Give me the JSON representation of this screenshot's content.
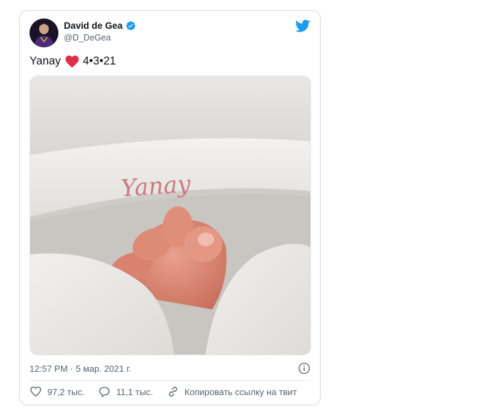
{
  "author": {
    "name": "David de Gea",
    "handle": "@D_DeGea",
    "verified": true
  },
  "tweet": {
    "text_prefix": "Yanay",
    "text_suffix": "4•3•21",
    "timestamp": "12:57 PM · 5 мар. 2021 г.",
    "image_embroidery": "Yanay"
  },
  "actions": {
    "likes": "97,2 тыс.",
    "replies": "11,1 тыс.",
    "copy_link": "Копировать ссылку на твит"
  },
  "icons": {
    "brand": "twitter-bird-icon",
    "verified": "verified-badge-icon",
    "info": "info-icon",
    "like": "heart-outline-icon",
    "reply": "reply-bubble-icon",
    "link": "link-icon"
  },
  "colors": {
    "twitter_blue": "#1d9bf0",
    "heart_red": "#dd2e44",
    "muted_text": "#536471"
  }
}
